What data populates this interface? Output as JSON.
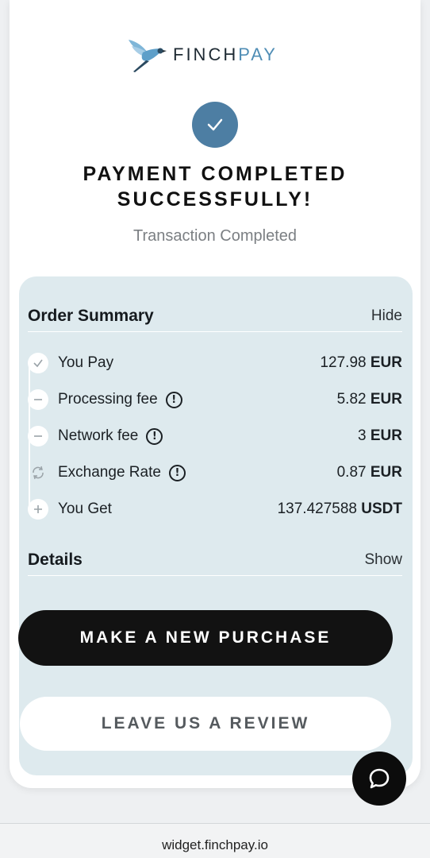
{
  "brand": {
    "name_part1": "FINCH",
    "name_part2": "PAY",
    "accent_color": "#4f8db5"
  },
  "status": {
    "icon": "check-icon",
    "title": "PAYMENT COMPLETED SUCCESSFULLY!",
    "subtitle": "Transaction Completed"
  },
  "order_summary": {
    "title": "Order Summary",
    "toggle": "Hide",
    "rows": [
      {
        "icon": "check-icon",
        "label": "You Pay",
        "amount": "127.98",
        "currency": "EUR",
        "info": false
      },
      {
        "icon": "minus-icon",
        "label": "Processing fee",
        "amount": "5.82",
        "currency": "EUR",
        "info": true
      },
      {
        "icon": "minus-icon",
        "label": "Network fee",
        "amount": "3",
        "currency": "EUR",
        "info": true
      },
      {
        "icon": "exchange-icon",
        "label": "Exchange Rate",
        "amount": "0.87",
        "currency": "EUR",
        "info": true
      },
      {
        "icon": "plus-icon",
        "label": "You Get",
        "amount": "137.427588",
        "currency": "USDT",
        "info": false
      }
    ],
    "info_glyph": "!"
  },
  "details": {
    "title": "Details",
    "toggle": "Show"
  },
  "buttons": {
    "new_purchase": "MAKE A NEW PURCHASE",
    "review": "LEAVE US A REVIEW"
  },
  "chat": {
    "icon": "chat-bubble-icon"
  },
  "footer": {
    "url": "widget.finchpay.io"
  },
  "colors": {
    "check_circle": "#4d7ea3",
    "summary_bg": "#deeaee",
    "primary_button": "#121212"
  }
}
